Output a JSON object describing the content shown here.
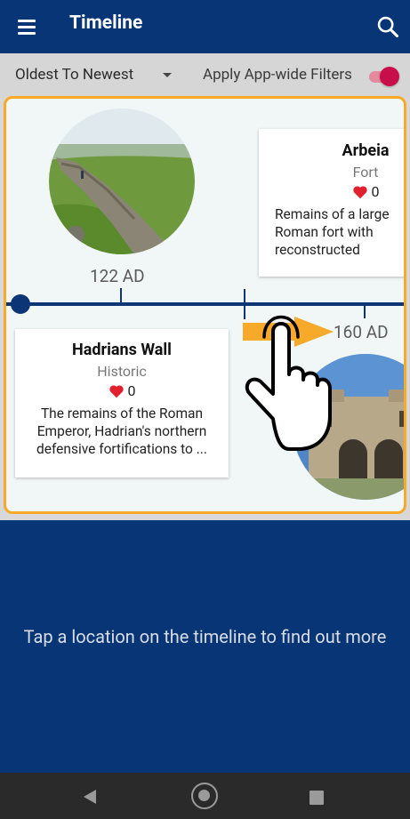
{
  "appbar": {
    "title": "Timeline",
    "menu_icon": "hamburger-menu-icon",
    "search_icon": "search-icon"
  },
  "filterbar": {
    "sort_value": "Oldest To Newest",
    "filters_label": "Apply App-wide Filters",
    "filters_enabled": true,
    "toggle_color": "#c70e4a"
  },
  "timeline": {
    "accent_color": "#f7a929",
    "axis_color": "#0c3575",
    "entries": [
      {
        "year": "122 AD",
        "name": "Hadrians Wall",
        "category": "Historic",
        "likes": "0",
        "description": "The remains of the Roman Emperor, Hadrian's northern defensive fortifications to ..."
      },
      {
        "year": "160 AD",
        "name": "Arbeia",
        "category": "Fort",
        "likes": "0",
        "description": "Remains of a large Roman fort with reconstructed gatehouse and living quarters"
      }
    ]
  },
  "info": {
    "text": "Tap a location on the timeline to find out more"
  },
  "navbar": {
    "back_icon": "back-triangle-icon",
    "home_icon": "home-circle-icon",
    "recents_icon": "recents-square-icon"
  }
}
